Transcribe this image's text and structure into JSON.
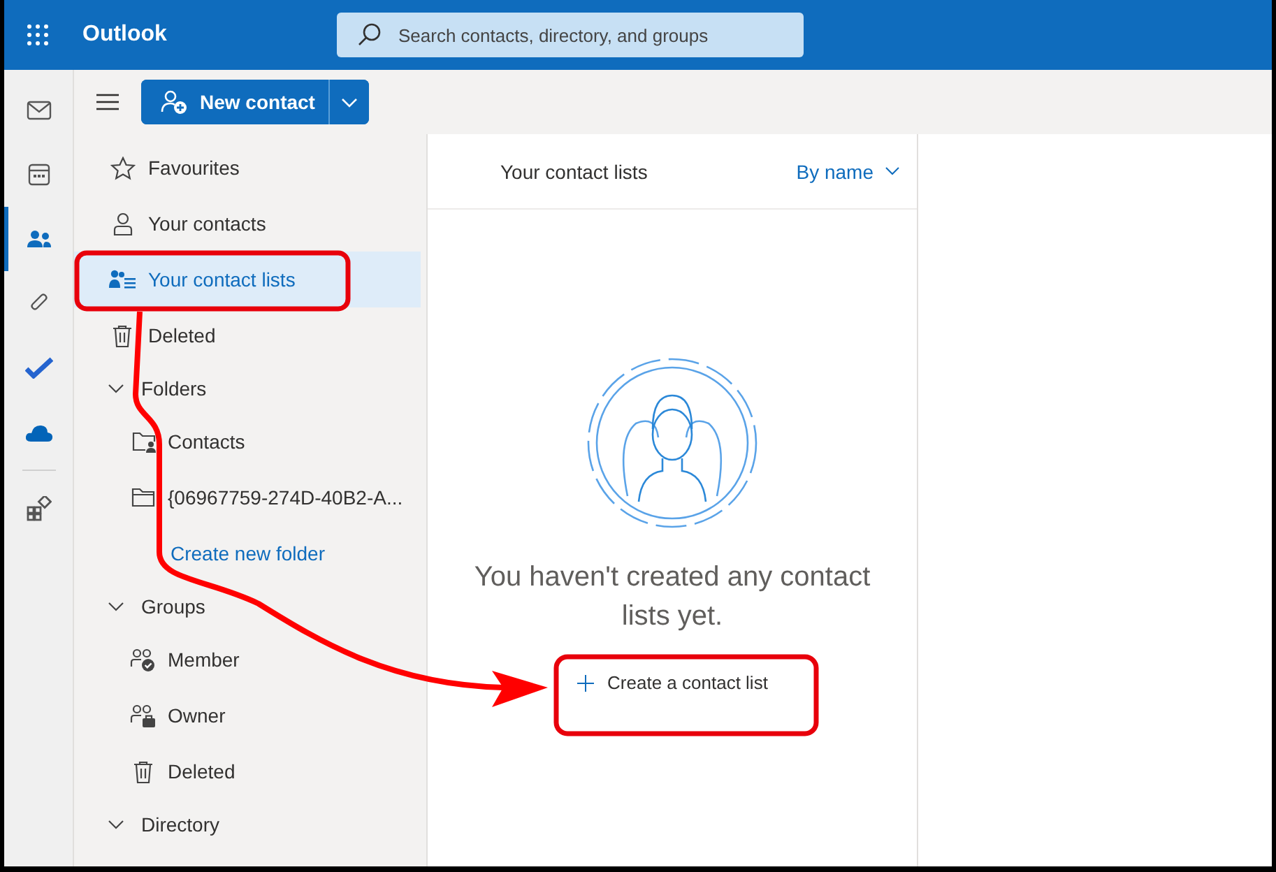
{
  "app": {
    "title": "Outlook"
  },
  "search": {
    "placeholder": "Search contacts, directory, and groups"
  },
  "rail": [
    {
      "kind": "mail",
      "selected": false
    },
    {
      "kind": "calendar",
      "selected": false
    },
    {
      "kind": "people",
      "selected": true
    },
    {
      "kind": "attachment",
      "selected": false
    },
    {
      "kind": "todo",
      "selected": false
    },
    {
      "kind": "cloud",
      "selected": false
    },
    {
      "kind": "apps",
      "selected": false
    }
  ],
  "toolbar": {
    "new_button": "New contact"
  },
  "sidebar": {
    "items": [
      {
        "kind": "item",
        "label": "Favourites",
        "selected": false
      },
      {
        "kind": "item",
        "label": "Your contacts",
        "selected": false
      },
      {
        "kind": "item",
        "label": "Your contact lists",
        "selected": true
      },
      {
        "kind": "item",
        "label": "Deleted",
        "selected": false
      },
      {
        "kind": "header",
        "label": "Folders",
        "expanded": true,
        "children": [
          {
            "kind": "item",
            "label": "Contacts",
            "selected": false
          },
          {
            "kind": "item",
            "label": "{06967759-274D-40B2-A...",
            "selected": false
          },
          {
            "kind": "link",
            "label": "Create new folder"
          }
        ]
      },
      {
        "kind": "header",
        "label": "Groups",
        "expanded": true,
        "children": [
          {
            "kind": "item",
            "label": "Member",
            "selected": false
          },
          {
            "kind": "item",
            "label": "Owner",
            "selected": false
          },
          {
            "kind": "item",
            "label": "Deleted",
            "selected": false
          }
        ]
      },
      {
        "kind": "header",
        "label": "Directory",
        "expanded": true
      }
    ]
  },
  "list_pane": {
    "title": "Your contact lists",
    "sort": "By name",
    "empty_message": "You haven't created any contact lists yet.",
    "create_button": "Create a contact list"
  }
}
